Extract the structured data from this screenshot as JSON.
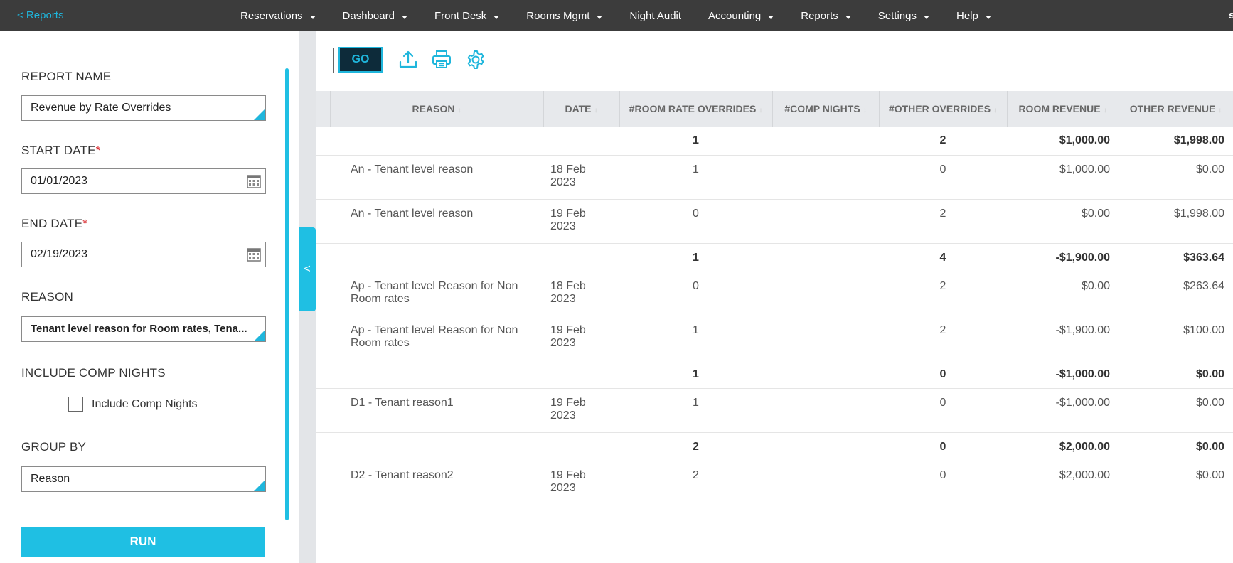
{
  "nav": {
    "back_label": "< Reports",
    "items": [
      "Reservations",
      "Dashboard",
      "Front Desk",
      "Rooms Mgmt",
      "Night Audit",
      "Accounting",
      "Reports",
      "Settings",
      "Help"
    ],
    "has_caret": [
      true,
      true,
      true,
      true,
      false,
      true,
      true,
      true,
      true
    ],
    "user_initial": "s"
  },
  "form": {
    "report_name_label": "REPORT NAME",
    "report_name_value": "Revenue by Rate Overrides",
    "start_date_label": "START DATE",
    "start_date_value": "01/01/2023",
    "end_date_label": "END DATE",
    "end_date_value": "02/19/2023",
    "required_mark": "*",
    "reason_label": "REASON",
    "reason_value": "Tenant level reason for Room rates, Tena...",
    "comp_label": "INCLUDE COMP NIGHTS",
    "comp_checkbox_label": "Include Comp Nights",
    "comp_checked": false,
    "group_by_label": "GROUP BY",
    "group_by_value": "Reason",
    "run_label": "RUN"
  },
  "collapse_label": "<",
  "toolbar": {
    "go_label": "GO",
    "icons": [
      "upload-icon",
      "print-icon",
      "settings-gear-icon"
    ]
  },
  "table": {
    "columns": [
      "REASON",
      "DATE",
      "#ROOM RATE OVERRIDES",
      "#COMP NIGHTS",
      "#OTHER OVERRIDES",
      "ROOM REVENUE",
      "OTHER REVENUE"
    ],
    "rows": [
      {
        "type": "group",
        "reason": "",
        "date1": "",
        "date2": "",
        "room_overrides": "1",
        "comp_nights": "",
        "other_overrides": "2",
        "room_revenue": "$1,000.00",
        "other_revenue": "$1,998.00"
      },
      {
        "type": "detail",
        "reason": "An - Tenant level reason",
        "date1": "18 Feb",
        "date2": "2023",
        "room_overrides": "1",
        "comp_nights": "",
        "other_overrides": "0",
        "room_revenue": "$1,000.00",
        "other_revenue": "$0.00"
      },
      {
        "type": "detail",
        "reason": "An - Tenant level reason",
        "date1": "19 Feb",
        "date2": "2023",
        "room_overrides": "0",
        "comp_nights": "",
        "other_overrides": "2",
        "room_revenue": "$0.00",
        "other_revenue": "$1,998.00"
      },
      {
        "type": "group",
        "reason": "",
        "date1": "",
        "date2": "",
        "room_overrides": "1",
        "comp_nights": "",
        "other_overrides": "4",
        "room_revenue": "-$1,900.00",
        "other_revenue": "$363.64"
      },
      {
        "type": "detail",
        "reason": "Ap - Tenant level Reason for Non Room rates",
        "date1": "18 Feb",
        "date2": "2023",
        "room_overrides": "0",
        "comp_nights": "",
        "other_overrides": "2",
        "room_revenue": "$0.00",
        "other_revenue": "$263.64"
      },
      {
        "type": "detail",
        "reason": "Ap - Tenant level Reason for Non Room rates",
        "date1": "19 Feb",
        "date2": "2023",
        "room_overrides": "1",
        "comp_nights": "",
        "other_overrides": "2",
        "room_revenue": "-$1,900.00",
        "other_revenue": "$100.00"
      },
      {
        "type": "group",
        "reason": "",
        "date1": "",
        "date2": "",
        "room_overrides": "1",
        "comp_nights": "",
        "other_overrides": "0",
        "room_revenue": "-$1,000.00",
        "other_revenue": "$0.00"
      },
      {
        "type": "detail",
        "reason": "D1 - Tenant reason1",
        "date1": "19 Feb",
        "date2": "2023",
        "room_overrides": "1",
        "comp_nights": "",
        "other_overrides": "0",
        "room_revenue": "-$1,000.00",
        "other_revenue": "$0.00"
      },
      {
        "type": "group",
        "reason": "",
        "date1": "",
        "date2": "",
        "room_overrides": "2",
        "comp_nights": "",
        "other_overrides": "0",
        "room_revenue": "$2,000.00",
        "other_revenue": "$0.00"
      },
      {
        "type": "detail",
        "reason": "D2 - Tenant reason2",
        "date1": "19 Feb",
        "date2": "2023",
        "room_overrides": "2",
        "comp_nights": "",
        "other_overrides": "0",
        "room_revenue": "$2,000.00",
        "other_revenue": "$0.00"
      }
    ]
  },
  "colors": {
    "accent": "#1fbfe3",
    "nav_bg": "#3c3c3c",
    "go_bg": "#0d2b3a",
    "required": "#d9262b"
  }
}
